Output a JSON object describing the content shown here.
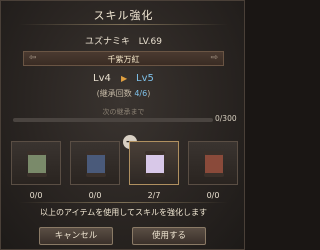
{
  "dialog": {
    "title": "スキル強化"
  },
  "character": {
    "name": "ユズナミキ",
    "level": "LV.69"
  },
  "skill": {
    "name": "千紫万紅"
  },
  "levels": {
    "current": "Lv4",
    "next": "Lv5"
  },
  "inherit": {
    "label": "(継承回数 ",
    "count": "4/6",
    "close": ")"
  },
  "progress": {
    "label": "次の継承まで",
    "value": "0/300",
    "fraction": 0.0
  },
  "items": [
    {
      "qty": "0/0",
      "color": "#7a8a6a",
      "selected": false
    },
    {
      "qty": "0/0",
      "color": "#4a5a7a",
      "selected": false
    },
    {
      "qty": "2/7",
      "color": "#d8c8e8",
      "selected": true
    },
    {
      "qty": "0/0",
      "color": "#8a4a3a",
      "selected": false
    }
  ],
  "description": "以上のアイテムを使用してスキルを強化します",
  "buttons": {
    "cancel": "キャンセル",
    "use": "使用する"
  }
}
